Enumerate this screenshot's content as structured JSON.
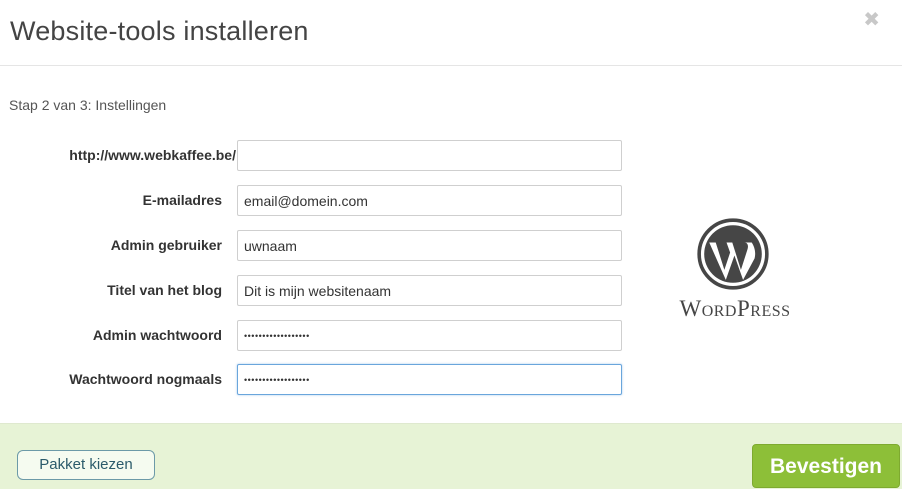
{
  "dialog": {
    "title": "Website-tools installeren",
    "close_icon": "close-icon"
  },
  "step": {
    "label": "Stap 2 van 3: Instellingen"
  },
  "form": {
    "fields": [
      {
        "label": "http://www.webkaffee.be/",
        "value": "",
        "placeholder": "",
        "type": "text"
      },
      {
        "label": "E-mailadres",
        "value": "email@domein.com",
        "placeholder": "",
        "type": "text"
      },
      {
        "label": "Admin gebruiker",
        "value": "uwnaam",
        "placeholder": "",
        "type": "text"
      },
      {
        "label": "Titel van het blog",
        "value": "Dit is mijn websitenaam",
        "placeholder": "",
        "type": "text"
      },
      {
        "label": "Admin wachtwoord",
        "value": "••••••••••••••••••",
        "placeholder": "",
        "type": "password"
      },
      {
        "label": "Wachtwoord nogmaals",
        "value": "••••••••••••••••••",
        "placeholder": "",
        "type": "password",
        "focused": true
      }
    ]
  },
  "logo": {
    "icon": "wordpress-logo-icon",
    "wordmark": "WordPress"
  },
  "footer": {
    "back_button": "Pakket kiezen",
    "confirm_button": "Bevestigen"
  },
  "colors": {
    "footer_bg": "#e7f3d6",
    "primary_button": "#8dbf38",
    "focus_border": "#6aa6dc"
  }
}
